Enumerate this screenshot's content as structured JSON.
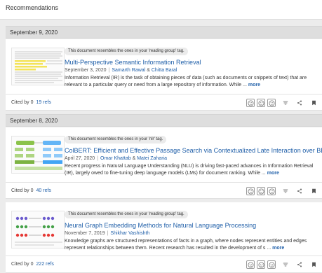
{
  "header": {
    "title": "Recommendations"
  },
  "groups": [
    {
      "date": "September 9, 2020",
      "card": {
        "tag": "This document resembles the ones in your 'reading group' tag.",
        "title": "Multi-Perspective Semantic Information Retrieval",
        "date": "September 3, 2020",
        "authors": [
          "Samarth Rawal",
          "Chitta Baral"
        ],
        "amp": "&",
        "abstract": "Information Retrieval (IR) is the task of obtaining pieces of data (such as documents or snippets of text) that are relevant to a particular query or need from a large repository of information. While ...",
        "more": "more",
        "cited_by": "Cited by 0",
        "refs": "19 refs"
      }
    },
    {
      "date": "September 8, 2020",
      "card": {
        "tag": "This document resembles the ones in your 'nlr' tag.",
        "title": "ColBERT: Efficient and Effective Passage Search via Contextualized Late Interaction over BERT",
        "date": "April 27, 2020",
        "authors": [
          "Omar Khattab",
          "Matei Zaharia"
        ],
        "amp": "&",
        "abstract": "Recent progress in Natural Language Understanding (NLU) is driving fast-paced advances in Information Retrieval (IR), largely owed to fine-tuning deep language models (LMs) for document ranking. While ...",
        "more": "more",
        "cited_by": "Cited by 0",
        "refs": "40 refs"
      }
    },
    {
      "date": "",
      "card": {
        "tag": "This document resembles the ones in your 'reading group' tag.",
        "title": "Neural Graph Embedding Methods for Natural Language Processing",
        "date": "November 7, 2019",
        "authors": [
          "Shikhar Vashishth"
        ],
        "abstract": "Knowledge graphs are structured representations of facts in a graph, where nodes represent entities and edges represent relationships between them. Recent research has resulted in the development of s ...",
        "more": "more",
        "cited_by": "Cited by 0",
        "refs": "222 refs"
      }
    }
  ],
  "footer_icons": [
    "sad-face-icon",
    "neutral-face-icon",
    "happy-face-icon",
    "filter-icon",
    "share-icon",
    "bookmark-icon"
  ],
  "colors": {
    "link": "#1e5ea8",
    "date_bar": "#dedede",
    "background": "#ececec"
  }
}
